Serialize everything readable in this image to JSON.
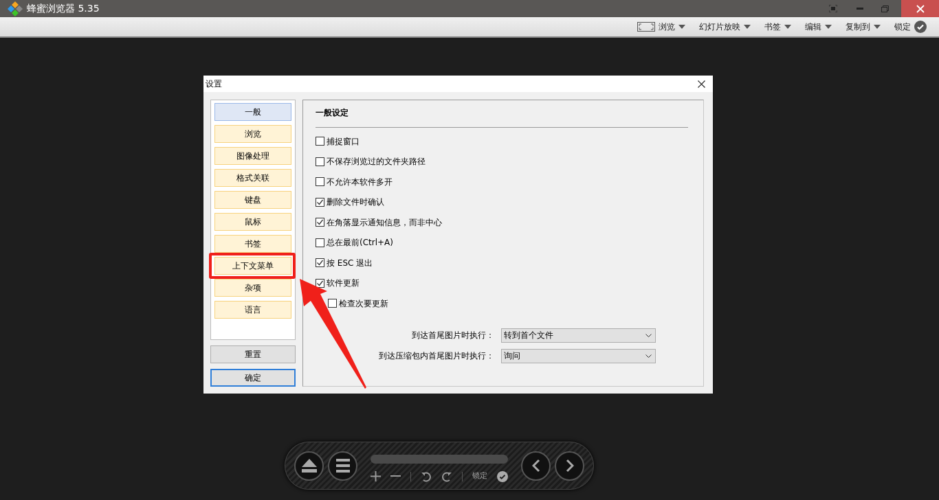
{
  "app": {
    "title": "蜂蜜浏览器 5.35"
  },
  "toolbar": [
    {
      "kind": "view",
      "label": "浏览"
    },
    {
      "kind": "menu",
      "label": "幻灯片放映"
    },
    {
      "kind": "menu",
      "label": "书签"
    },
    {
      "kind": "menu",
      "label": "编辑"
    },
    {
      "kind": "menu",
      "label": "复制到"
    },
    {
      "kind": "lock",
      "label": "锁定"
    }
  ],
  "dialog": {
    "title": "设置",
    "sidebar": [
      {
        "label": "一般",
        "selected": true,
        "highlighted": false
      },
      {
        "label": "浏览",
        "selected": false,
        "highlighted": false
      },
      {
        "label": "图像处理",
        "selected": false,
        "highlighted": false
      },
      {
        "label": "格式关联",
        "selected": false,
        "highlighted": false
      },
      {
        "label": "键盘",
        "selected": false,
        "highlighted": false
      },
      {
        "label": "鼠标",
        "selected": false,
        "highlighted": false
      },
      {
        "label": "书签",
        "selected": false,
        "highlighted": false
      },
      {
        "label": "上下文菜单",
        "selected": false,
        "highlighted": true
      },
      {
        "label": "杂项",
        "selected": false,
        "highlighted": false
      },
      {
        "label": "语言",
        "selected": false,
        "highlighted": false
      }
    ],
    "buttons": [
      {
        "label": "重置",
        "default": false
      },
      {
        "label": "确定",
        "default": true
      }
    ],
    "section_title": "一般设定",
    "options": [
      {
        "label": "捕捉窗口",
        "checked": false
      },
      {
        "label": "不保存浏览过的文件夹路径",
        "checked": false
      },
      {
        "label": "不允许本软件多开",
        "checked": false
      },
      {
        "label": "删除文件时确认",
        "checked": true
      },
      {
        "label": "在角落显示通知信息，而非中心",
        "checked": true
      },
      {
        "label": "总在最前(Ctrl+A)",
        "checked": false
      },
      {
        "label": "按 ESC 退出",
        "checked": true
      },
      {
        "label": "软件更新",
        "checked": true,
        "children": [
          {
            "label": "检查次要更新",
            "checked": false
          }
        ]
      }
    ],
    "selects": [
      {
        "label": "到达首尾图片时执行：",
        "value": "转到首个文件"
      },
      {
        "label": "到达压缩包内首尾图片时执行：",
        "value": "询问"
      }
    ]
  },
  "control_bar": {
    "lock_label": "锁定"
  }
}
